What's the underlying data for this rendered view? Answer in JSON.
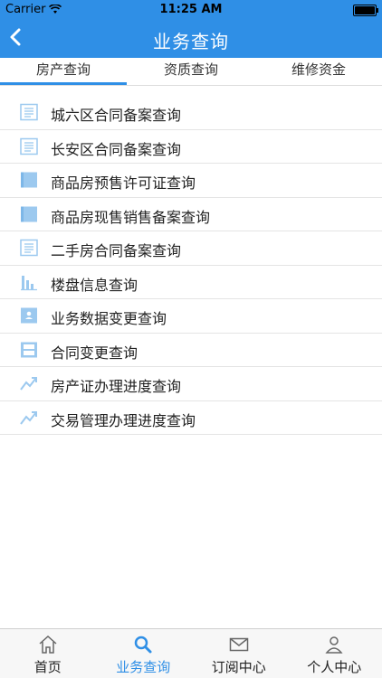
{
  "status_bar": {
    "carrier": "Carrier",
    "time": "11:25 AM"
  },
  "nav": {
    "title": "业务查询"
  },
  "tabs": [
    {
      "label": "房产查询",
      "active": true
    },
    {
      "label": "资质查询",
      "active": false
    },
    {
      "label": "维修资金",
      "active": false
    }
  ],
  "list": [
    {
      "label": "城六区合同备案查询",
      "icon": "document-list-icon"
    },
    {
      "label": "长安区合同备案查询",
      "icon": "document-list-icon"
    },
    {
      "label": "商品房预售许可证查询",
      "icon": "panel-icon"
    },
    {
      "label": "商品房现售销售备案查询",
      "icon": "panel-icon"
    },
    {
      "label": "二手房合同备案查询",
      "icon": "document-list-icon"
    },
    {
      "label": "楼盘信息查询",
      "icon": "bar-chart-icon"
    },
    {
      "label": "业务数据变更查询",
      "icon": "person-card-icon"
    },
    {
      "label": "合同变更查询",
      "icon": "cabinet-icon"
    },
    {
      "label": "房产证办理进度查询",
      "icon": "trend-icon"
    },
    {
      "label": "交易管理办理进度查询",
      "icon": "trend-icon"
    }
  ],
  "tab_bar": [
    {
      "label": "首页",
      "icon": "home-icon",
      "active": false
    },
    {
      "label": "业务查询",
      "icon": "search-icon",
      "active": true
    },
    {
      "label": "订阅中心",
      "icon": "mail-icon",
      "active": false
    },
    {
      "label": "个人中心",
      "icon": "person-icon",
      "active": false
    }
  ],
  "colors": {
    "accent": "#2f8fe6",
    "icon_blue": "#9cc9ef"
  }
}
